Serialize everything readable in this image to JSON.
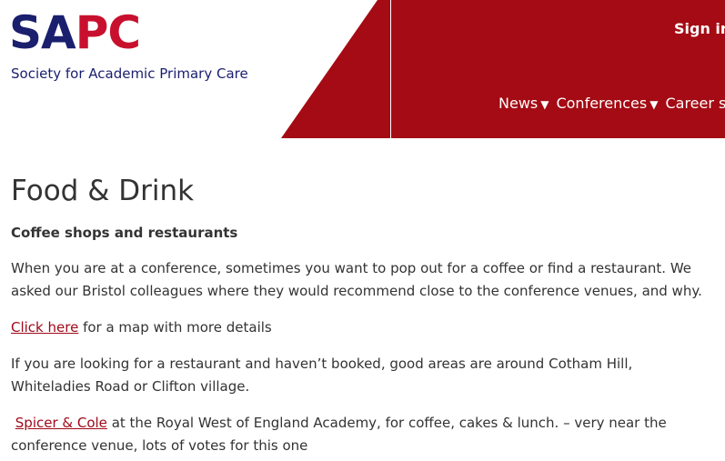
{
  "header": {
    "logo_part1": "SA",
    "logo_part2": "PC",
    "tagline": "Society for Academic Primary Care",
    "signin_label": "Sign in",
    "nav": [
      {
        "label": "News"
      },
      {
        "label": "Conferences"
      },
      {
        "label": "Career su"
      }
    ]
  },
  "colors": {
    "brand_red": "#a40b14",
    "brand_navy": "#1a1f6e",
    "logo_red": "#c8102e",
    "link": "#a0091a"
  },
  "content": {
    "title": "Food & Drink",
    "subheading": "Coffee shops and restaurants",
    "para1": "When you are at a conference, sometimes you want to pop out for a coffee or find a restaurant. We asked our Bristol colleagues where they would recommend close to the conference venues, and why.",
    "para2_link": "Click here",
    "para2_rest": " for a map with more details",
    "para3": "If you are looking for a restaurant and haven’t booked, good areas are around Cotham Hill, Whiteladies Road or Clifton village.",
    "para4_link": "Spicer & Cole",
    "para4_rest": " at the Royal West of England Academy, for coffee, cakes & lunch. – very near the conference venue, lots of votes for this one"
  }
}
